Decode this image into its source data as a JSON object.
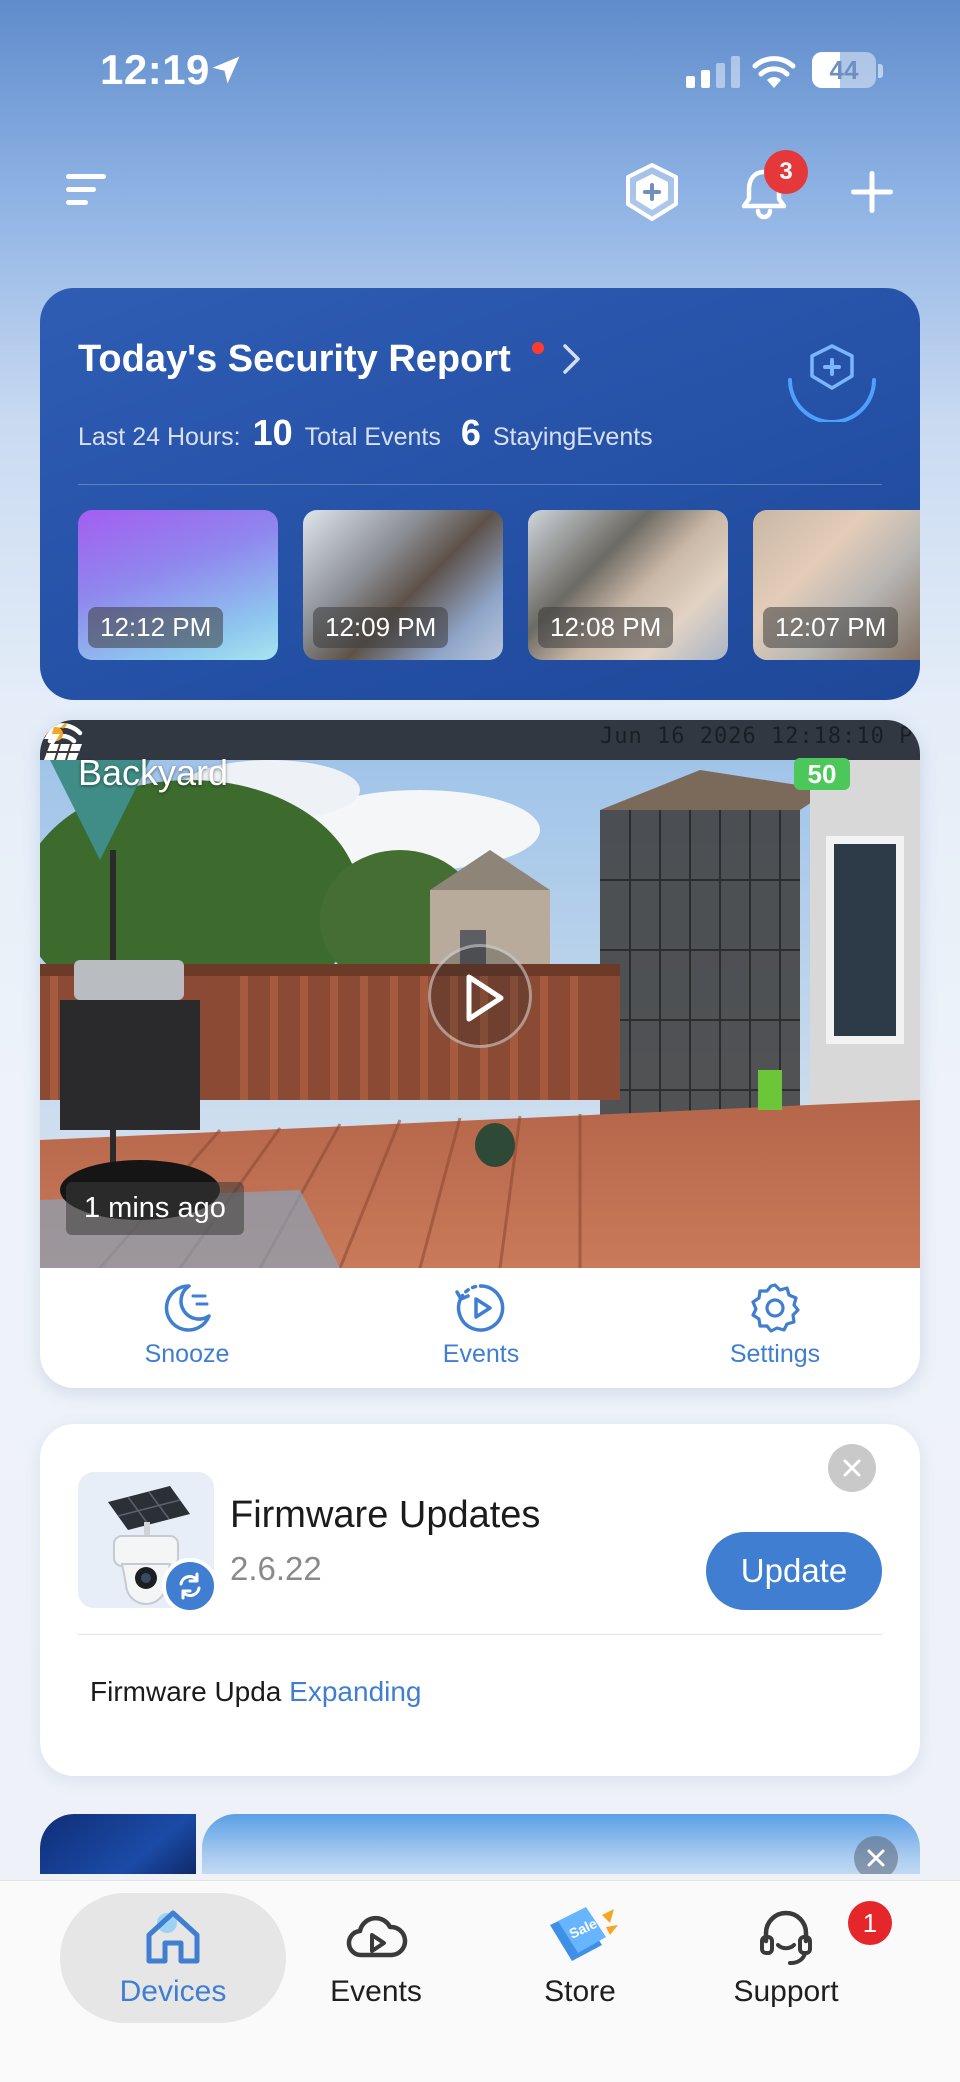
{
  "status_bar": {
    "time": "12:19",
    "battery": "44"
  },
  "header": {
    "notifications_count": "3"
  },
  "security_report": {
    "title": "Today's Security Report",
    "range_label": "Last 24 Hours:",
    "total_events_count": "10",
    "total_events_label": "Total Events",
    "staying_events_count": "6",
    "staying_events_label": "StayingEvents",
    "thumbnails": [
      {
        "time": "12:12 PM"
      },
      {
        "time": "12:09 PM"
      },
      {
        "time": "12:08 PM"
      },
      {
        "time": "12:07 PM"
      }
    ]
  },
  "camera": {
    "name": "Backyard",
    "overlay_timestamp": "Jun 16 2026 12:18:10 P",
    "battery": "50",
    "last_seen": "1 mins ago",
    "actions": [
      {
        "label": "Snooze",
        "icon": "snooze-moon-icon"
      },
      {
        "label": "Events",
        "icon": "events-play-icon"
      },
      {
        "label": "Settings",
        "icon": "gear-icon"
      }
    ]
  },
  "firmware": {
    "title": "Firmware Updates",
    "version": "2.6.22",
    "update_label": "Update",
    "note": "Firmware Upda",
    "expand_label": "Expanding"
  },
  "bottom_nav": {
    "items": [
      {
        "label": "Devices",
        "icon": "home-icon",
        "active": true
      },
      {
        "label": "Events",
        "icon": "cloud-play-icon"
      },
      {
        "label": "Store",
        "icon": "sale-tag-icon"
      },
      {
        "label": "Support",
        "icon": "headset-icon"
      }
    ],
    "support_badge": "1"
  },
  "colors": {
    "accent": "#3f7ed1",
    "report_card": "#2a56aa",
    "badge_red": "#e5383b",
    "camera_battery": "#4cc85a"
  }
}
